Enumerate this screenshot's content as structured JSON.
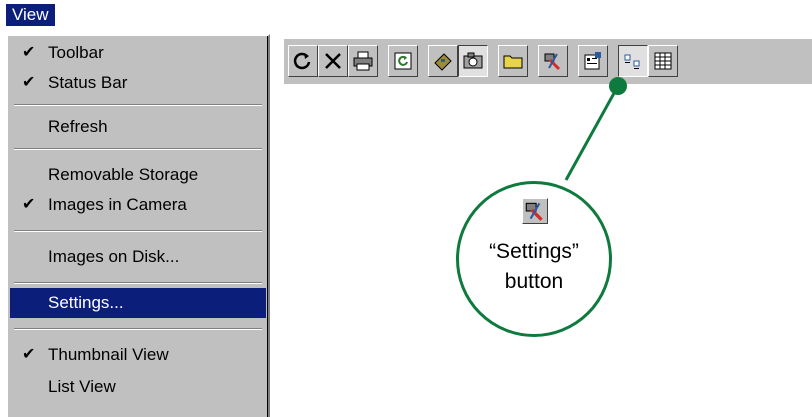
{
  "menu": {
    "title": "View",
    "items": [
      {
        "label": "Toolbar",
        "checked": true
      },
      {
        "label": "Status Bar",
        "checked": true
      },
      {
        "label": "Refresh",
        "checked": false
      },
      {
        "label": "Removable Storage",
        "checked": false
      },
      {
        "label": "Images in Camera",
        "checked": true
      },
      {
        "label": "Images on Disk...",
        "checked": false
      },
      {
        "label": "Settings...",
        "checked": false,
        "selected": true
      },
      {
        "label": "Thumbnail View",
        "checked": true
      },
      {
        "label": "List View",
        "checked": false
      }
    ],
    "check_glyph": "✔"
  },
  "toolbar": {
    "buttons": [
      "refresh-icon",
      "delete-icon",
      "print-icon",
      "rotate-icon",
      "removable-storage-icon",
      "camera-icon",
      "folder-icon",
      "settings-icon",
      "properties-icon",
      "thumbnail-view-icon",
      "list-view-icon"
    ]
  },
  "callout": {
    "line1": "“Settings”",
    "line2": "button"
  },
  "colors": {
    "accent_green": "#0e7a3d",
    "selection_blue": "#0a1e7a",
    "window_gray": "#c0c0c0"
  }
}
